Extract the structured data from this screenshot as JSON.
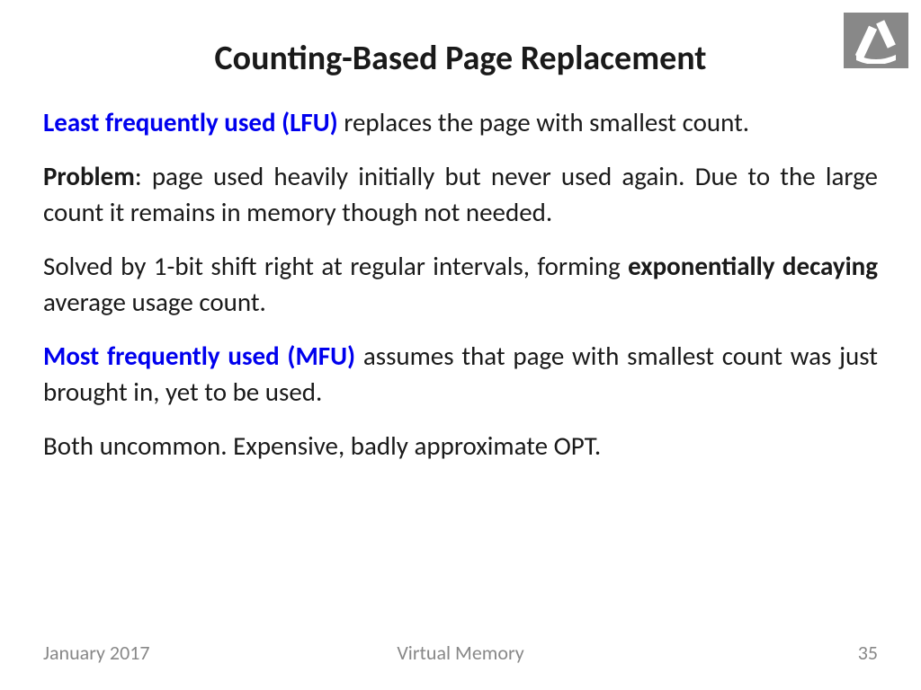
{
  "title": "Counting-Based Page Replacement",
  "paragraphs": {
    "p1_lead": "Least frequently used (LFU)",
    "p1_rest": " replaces the page with smallest count.",
    "p2_lead": "Problem",
    "p2_rest": ": page used heavily initially but never used again.  Due to the large count it remains in memory though not needed.",
    "p3_pre": "Solved by 1-bit shift right at regular intervals, forming ",
    "p3_bold": "exponentially decaying",
    "p3_post": " average usage count.",
    "p4_lead": "Most frequently used (MFU)",
    "p4_rest": " assumes that page with smallest count was just brought in, yet to be used.",
    "p5": "Both uncommon. Expensive, badly approximate OPT."
  },
  "footer": {
    "left": "January 2017",
    "center": "Virtual Memory",
    "right": "35"
  }
}
